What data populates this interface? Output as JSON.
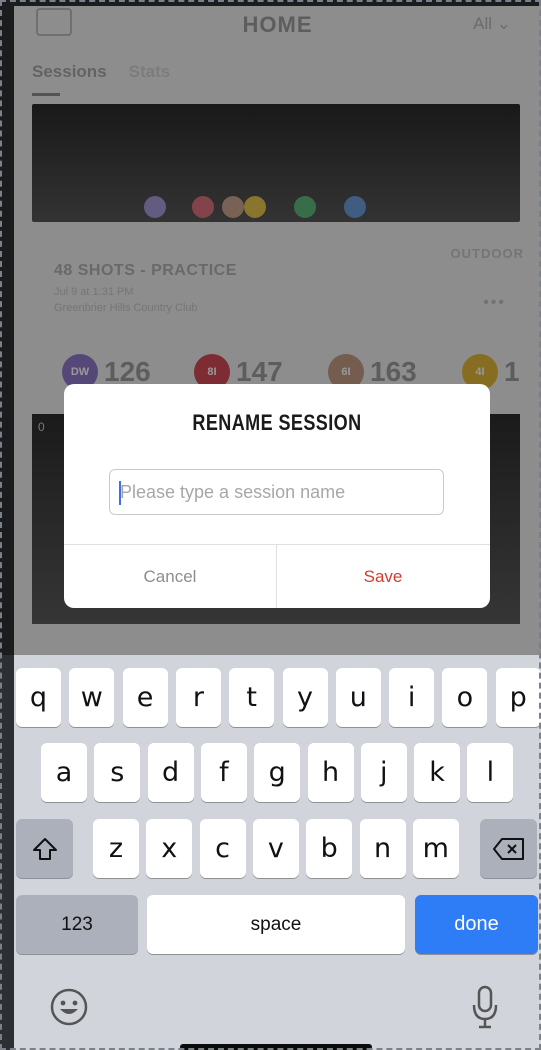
{
  "app": {
    "header_title": "HOME",
    "filter": "All",
    "tabs": [
      "Sessions",
      "Stats"
    ]
  },
  "card": {
    "label": "OUTDOOR",
    "title": "48 SHOTS - PRACTICE",
    "date": "Jul 9 at 1:31 PM",
    "place": "Greenbrier Hills Country Club",
    "more": "•••"
  },
  "stats": [
    {
      "badge": "DW",
      "value": "126",
      "color": "#8e79c9"
    },
    {
      "badge": "8I",
      "value": "147",
      "color": "#d24a55"
    },
    {
      "badge": "6I",
      "value": "163",
      "color": "#c29a82"
    },
    {
      "badge": "4I",
      "value": "1",
      "color": "#e2b63a"
    }
  ],
  "chart2_label": "0",
  "dialog": {
    "title": "RENAME SESSION",
    "input_placeholder": "Please type a session name",
    "input_value": "",
    "cancel_label": "Cancel",
    "save_label": "Save",
    "save_color": "#d23d2a"
  },
  "keyboard": {
    "row1": [
      "q",
      "w",
      "e",
      "r",
      "t",
      "y",
      "u",
      "i",
      "o",
      "p"
    ],
    "row2": [
      "a",
      "s",
      "d",
      "f",
      "g",
      "h",
      "j",
      "k",
      "l"
    ],
    "row3": [
      "z",
      "x",
      "c",
      "v",
      "b",
      "n",
      "m"
    ],
    "numbers_label": "123",
    "space_label": "space",
    "done_label": "done",
    "shift_icon": "shift-icon",
    "delete_icon": "backspace-icon",
    "emoji_icon": "emoji-icon",
    "mic_icon": "microphone-icon",
    "done_color": "#2e7cf6"
  }
}
